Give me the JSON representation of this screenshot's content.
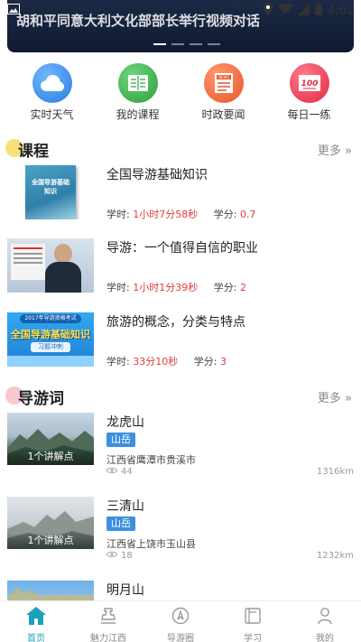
{
  "status_bar": {
    "time": "4:01"
  },
  "banner": {
    "title": "胡和平同意大利文化部部长举行视频对话"
  },
  "quick_nav": [
    {
      "label": "实时天气",
      "icon": "cloud-icon",
      "color": "#3c8ee8"
    },
    {
      "label": "我的课程",
      "icon": "book-icon",
      "color": "#3ab64a"
    },
    {
      "label": "时政要闻",
      "icon": "news-icon",
      "color": "#f06a3c"
    },
    {
      "label": "每日一练",
      "icon": "score-icon",
      "color": "#ec3d52"
    }
  ],
  "courses_section": {
    "title": "课程",
    "more": "更多 »",
    "dot_color": "#f7e27a"
  },
  "courses": [
    {
      "title": "全国导游基础知识",
      "hours_label": "学时:",
      "hours": "1小时7分58秒",
      "credit_label": "学分:",
      "credit": "0.7"
    },
    {
      "title": "导游：一个值得自信的职业",
      "hours_label": "学时:",
      "hours": "1小时1分39秒",
      "credit_label": "学分:",
      "credit": "2"
    },
    {
      "title": "旅游的概念，分类与特点",
      "hours_label": "学时:",
      "hours": "33分10秒",
      "credit_label": "学分:",
      "credit": "3"
    }
  ],
  "course_thumbs": {
    "book_title": "全国导游基础知识",
    "banner_top": "2017年导游资格考试",
    "banner_main": "全国导游基础知识",
    "banner_sub": "习题冲刺"
  },
  "guides_section": {
    "title": "导游词",
    "more": "更多 »",
    "dot_color": "#f9c7cf"
  },
  "guides": [
    {
      "title": "龙虎山",
      "tag": "山岳",
      "address": "江西省鹰潭市贵溪市",
      "views": "44",
      "distance": "1316km",
      "overlay": "1个讲解点"
    },
    {
      "title": "三清山",
      "tag": "山岳",
      "address": "江西省上饶市玉山县",
      "views": "18",
      "distance": "1232km",
      "overlay": "1个讲解点"
    },
    {
      "title": "明月山",
      "tag": "",
      "address": "",
      "views": "",
      "distance": "",
      "overlay": ""
    }
  ],
  "tabs": [
    {
      "label": "首页",
      "icon": "home-icon",
      "active": true
    },
    {
      "label": "魅力江西",
      "icon": "charm-icon",
      "active": false
    },
    {
      "label": "导游圈",
      "icon": "compass-icon",
      "active": false
    },
    {
      "label": "学习",
      "icon": "study-icon",
      "active": false
    },
    {
      "label": "我的",
      "icon": "profile-icon",
      "active": false
    }
  ],
  "colors": {
    "accent": "#1aa0b8",
    "red": "#e23b3b",
    "tag_blue": "#3d8fe0"
  }
}
